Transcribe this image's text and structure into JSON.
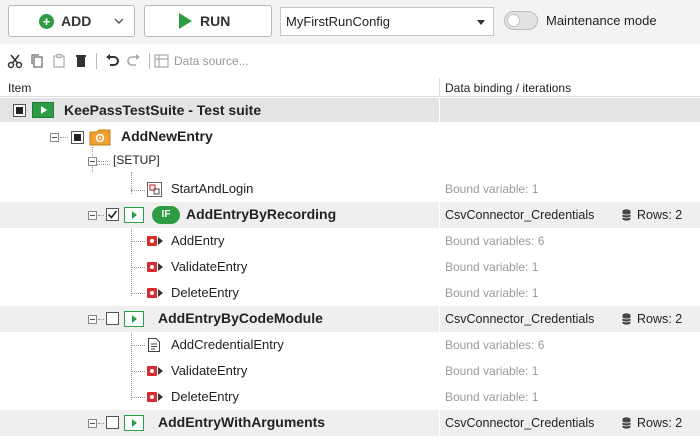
{
  "topbar": {
    "add_label": "ADD",
    "run_label": "RUN",
    "run_config": "MyFirstRunConfig",
    "maintenance_label": "Maintenance mode",
    "accent_green": "#2e9c45"
  },
  "toolbar": {
    "icons": [
      "cut-icon",
      "copy-icon",
      "paste-icon",
      "delete-icon",
      "undo-icon",
      "redo-icon",
      "data-source-icon"
    ],
    "data_source_label": "Data source..."
  },
  "headers": {
    "item": "Item",
    "data_binding": "Data binding / iterations"
  },
  "tree": {
    "suite": {
      "label": "KeePassTestSuite - Test suite"
    },
    "add_new_entry": {
      "label": "AddNewEntry"
    },
    "setup": {
      "label": "[SETUP]"
    },
    "start_and_login": {
      "label": "StartAndLogin",
      "binding": "Bound variable: 1"
    },
    "add_entry_by_recording": {
      "label": "AddEntryByRecording",
      "binding": "CsvConnector_Credentials",
      "rows": "Rows: 2",
      "badge": "IF",
      "children": [
        {
          "label": "AddEntry",
          "binding": "Bound variables: 6"
        },
        {
          "label": "ValidateEntry",
          "binding": "Bound variable: 1"
        },
        {
          "label": "DeleteEntry",
          "binding": "Bound variable: 1"
        }
      ]
    },
    "add_entry_by_code_module": {
      "label": "AddEntryByCodeModule",
      "binding": "CsvConnector_Credentials",
      "rows": "Rows: 2",
      "children": [
        {
          "label": "AddCredentialEntry",
          "binding": "Bound variables: 6"
        },
        {
          "label": "ValidateEntry",
          "binding": "Bound variable: 1"
        },
        {
          "label": "DeleteEntry",
          "binding": "Bound variable: 1"
        }
      ]
    },
    "add_entry_with_arguments": {
      "label": "AddEntryWithArguments",
      "binding": "CsvConnector_Credentials",
      "rows": "Rows: 2"
    }
  }
}
